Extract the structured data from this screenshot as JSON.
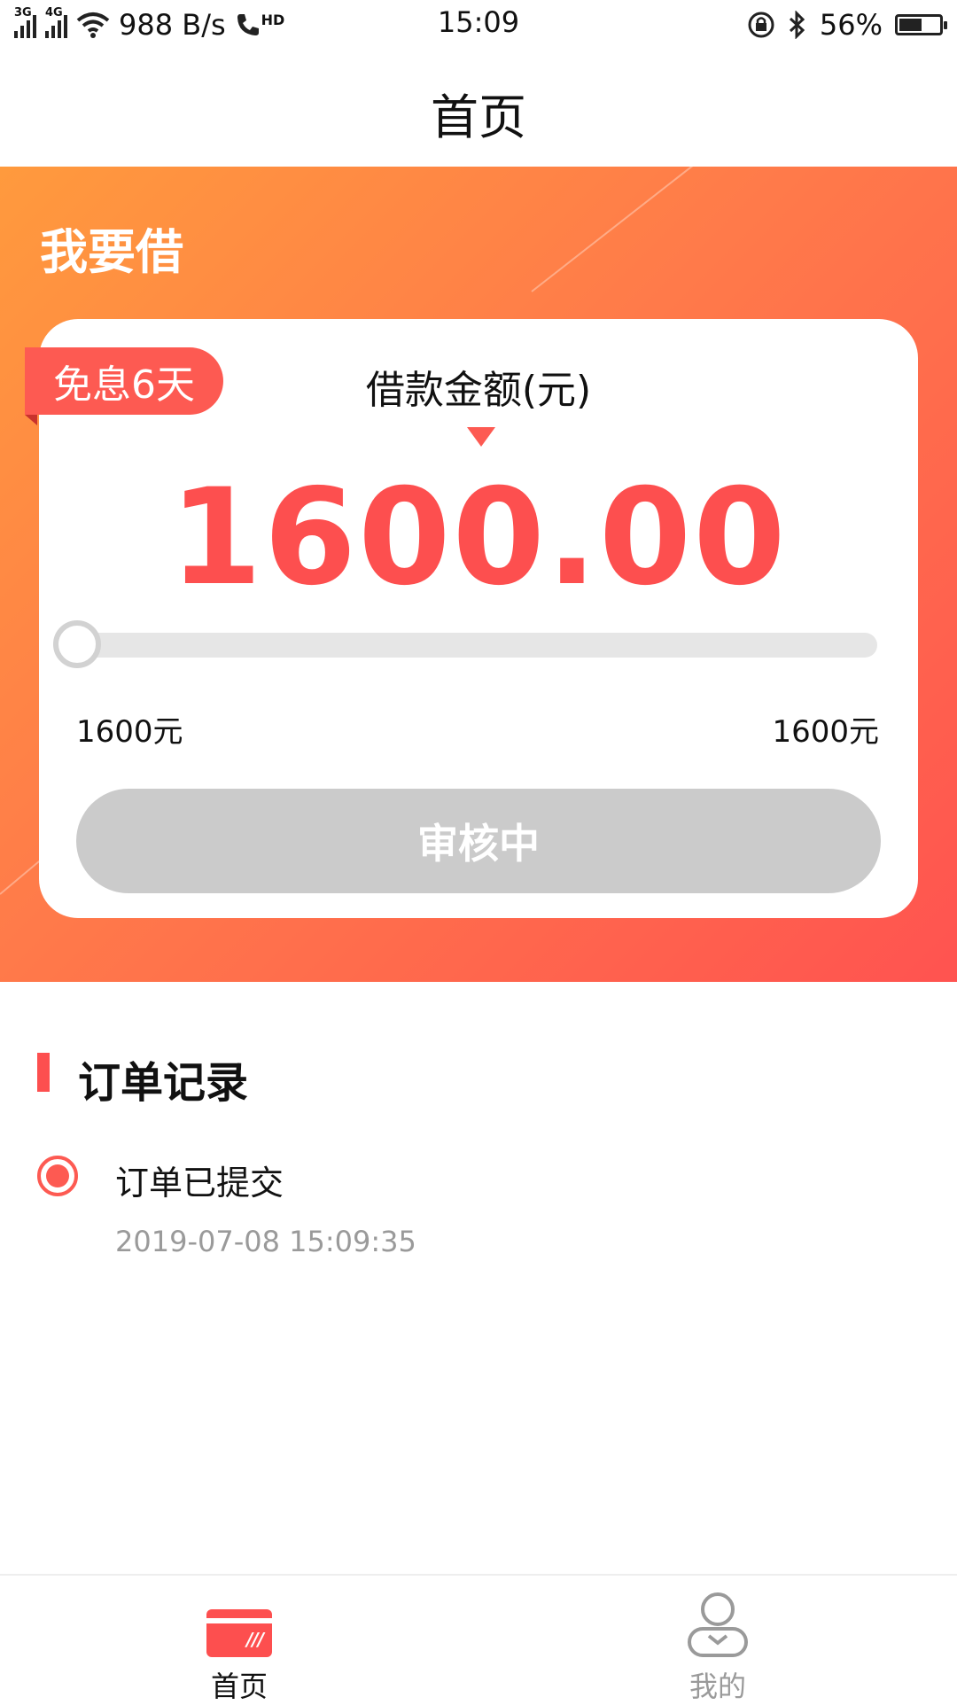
{
  "status_bar": {
    "network_1": "3G",
    "network_2": "4G",
    "speed": "988 B/s",
    "hd": "HD",
    "time": "15:09",
    "battery": "56%",
    "battery_level": 0.56
  },
  "header": {
    "title": "首页"
  },
  "loan": {
    "section_title": "我要借",
    "badge": "免息6天",
    "amount_label": "借款金额(元)",
    "amount_value": "1600.00",
    "slider_fraction": 0.0,
    "range_min": "1600元",
    "range_max": "1600元",
    "button_label": "审核中"
  },
  "orders": {
    "title": "订单记录",
    "items": [
      {
        "status": "订单已提交",
        "time": "2019-07-08 15:09:35"
      }
    ]
  },
  "tabbar": {
    "home_label": "首页",
    "mine_label": "我的"
  },
  "colors": {
    "accent": "#fd4f4f",
    "hero_start": "#ff9a3d",
    "hero_end": "#ff5350",
    "disabled_button": "#cbcbcb"
  },
  "icons": [
    "signal-icon",
    "wifi-icon",
    "hd-call-icon",
    "rotation-lock-icon",
    "bluetooth-icon",
    "battery-icon",
    "home-card-icon",
    "profile-icon"
  ]
}
